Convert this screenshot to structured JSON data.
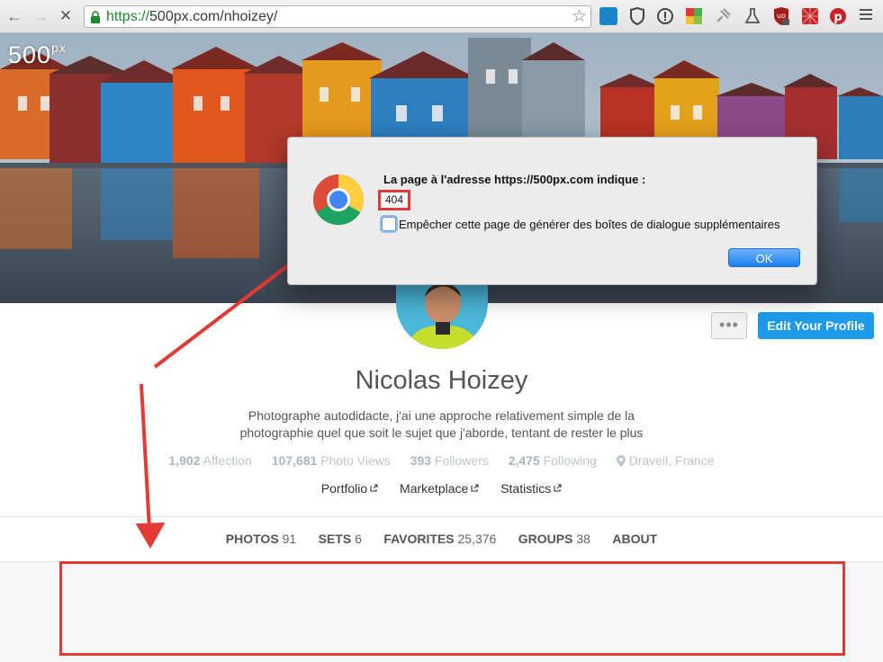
{
  "browser": {
    "url_scheme": "https://",
    "url_rest": "500px.com/nhoizey/"
  },
  "site": {
    "logo_main": "500",
    "logo_sup": "px"
  },
  "profile": {
    "more_label": "•••",
    "edit_label": "Edit Your Profile",
    "name": "Nicolas Hoizey",
    "bio_line1": "Photographe autodidacte, j'ai une approche relativement simple de la",
    "bio_line2": "photographie quel que soit le sujet que j'aborde, tentant de rester le plus",
    "stats": [
      {
        "value": "1,902",
        "label": "Affection"
      },
      {
        "value": "107,681",
        "label": "Photo Views"
      },
      {
        "value": "393",
        "label": "Followers"
      },
      {
        "value": "2,475",
        "label": "Following"
      }
    ],
    "location": "Draveil, France",
    "links": [
      "Portfolio",
      "Marketplace",
      "Statistics"
    ]
  },
  "tabs": [
    {
      "label": "PHOTOS",
      "count": "91"
    },
    {
      "label": "SETS",
      "count": "6"
    },
    {
      "label": "FAVORITES",
      "count": "25,376"
    },
    {
      "label": "GROUPS",
      "count": "38"
    },
    {
      "label": "ABOUT",
      "count": ""
    }
  ],
  "dialog": {
    "title": "La page à l'adresse https://500px.com indique :",
    "message": "404",
    "checkbox_label": "Empêcher cette page de générer des boîtes de dialogue supplémentaires",
    "ok_label": "OK"
  },
  "colors": {
    "accent": "#1d9be8",
    "annotation": "#e53935"
  }
}
